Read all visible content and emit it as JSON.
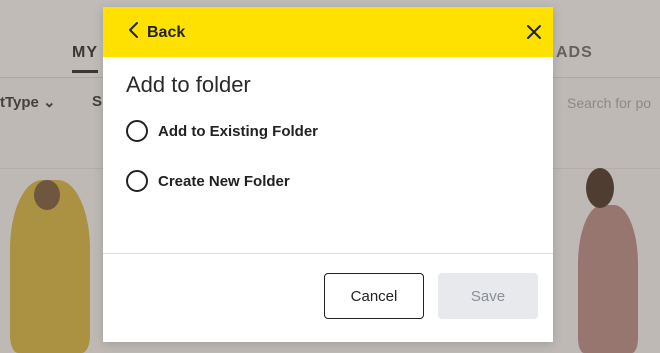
{
  "background": {
    "tab_active": "MY",
    "tab_right": "ADS",
    "filter_1": "tType ⌄",
    "filter_2": "S",
    "search_placeholder": "Search for po"
  },
  "modal": {
    "back_label": "Back",
    "title": "Add to folder",
    "options": [
      {
        "label": "Add to Existing Folder",
        "selected": false
      },
      {
        "label": "Create New Folder",
        "selected": false
      }
    ],
    "cancel_label": "Cancel",
    "save_label": "Save",
    "header_color": "#ffe100",
    "icons": {
      "back": "chevron-left-icon",
      "close": "close-icon"
    }
  }
}
